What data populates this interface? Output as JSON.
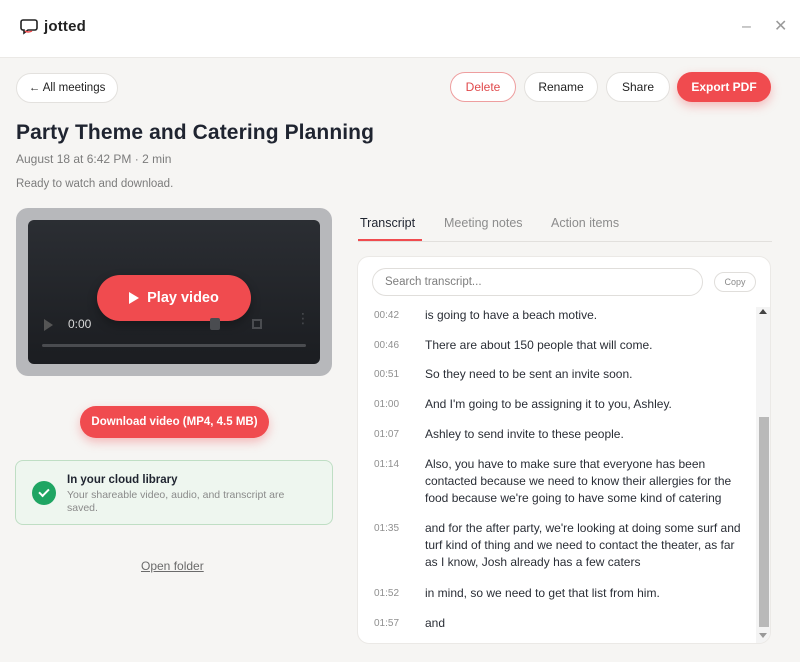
{
  "app": {
    "name": "jotted",
    "minimize_glyph": "–",
    "close_glyph": "✕"
  },
  "header": {
    "back_label": "← All meetings",
    "delete_label": "Delete",
    "rename_label": "Rename",
    "share_label": "Share",
    "export_label": "Export PDF"
  },
  "meeting": {
    "title": "Party Theme and Catering Planning",
    "meta": "August 18 at 6:42 PM · 2 min",
    "status": "Ready to watch and download."
  },
  "video": {
    "play_label": "Play video",
    "current_time": "0:00",
    "download_label": "Download video (MP4, 4.5 MB)"
  },
  "cloud": {
    "title": "In your cloud library",
    "description": "Your shareable video, audio, and transcript are saved."
  },
  "open_folder_label": "Open folder",
  "tabs": [
    {
      "label": "Transcript",
      "active": true
    },
    {
      "label": "Meeting notes",
      "active": false
    },
    {
      "label": "Action items",
      "active": false
    }
  ],
  "transcript": {
    "search_placeholder": "Search transcript...",
    "copy_label": "Copy",
    "rows": [
      {
        "time": "00:42",
        "text": "is going to have a beach motive."
      },
      {
        "time": "00:46",
        "text": "There are about 150 people that will come."
      },
      {
        "time": "00:51",
        "text": "So they need to be sent an invite soon."
      },
      {
        "time": "01:00",
        "text": "And I'm going to be assigning it to you, Ashley."
      },
      {
        "time": "01:07",
        "text": "Ashley to send invite to these people."
      },
      {
        "time": "01:14",
        "text": "Also, you have to make sure that everyone has been contacted because we need to know their allergies for the food because we're going to have some kind of catering"
      },
      {
        "time": "01:35",
        "text": "and for the after party, we're looking at doing some surf and turf kind of thing and we need to contact the theater, as far as I know, Josh already has a few caters"
      },
      {
        "time": "01:52",
        "text": "in mind, so we need to get that list from him."
      },
      {
        "time": "01:57",
        "text": "and"
      }
    ]
  },
  "colors": {
    "accent": "#f04b4f",
    "success": "#1fa563"
  }
}
